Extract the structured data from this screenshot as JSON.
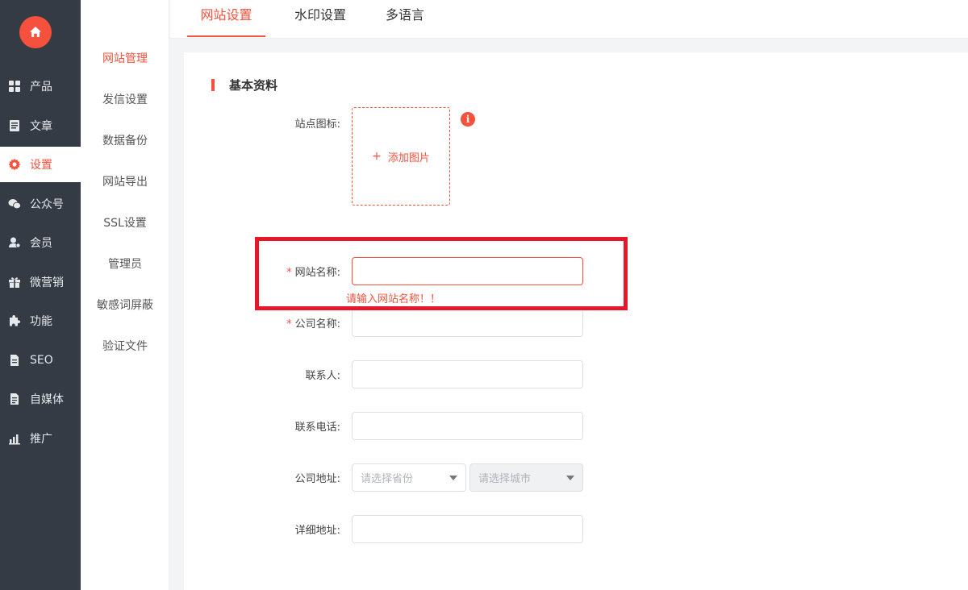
{
  "sidebar": {
    "items": [
      {
        "label": "产品",
        "icon": "grid-icon"
      },
      {
        "label": "文章",
        "icon": "document-icon"
      },
      {
        "label": "设置",
        "icon": "gear-icon",
        "active": true
      },
      {
        "label": "公众号",
        "icon": "wechat-icon"
      },
      {
        "label": "会员",
        "icon": "user-icon"
      },
      {
        "label": "微营销",
        "icon": "gift-icon"
      },
      {
        "label": "功能",
        "icon": "puzzle-icon"
      },
      {
        "label": "SEO",
        "icon": "seo-file-icon"
      },
      {
        "label": "自媒体",
        "icon": "media-file-icon"
      },
      {
        "label": "推广",
        "icon": "chart-icon"
      }
    ]
  },
  "submenu": {
    "items": [
      "网站管理",
      "发信设置",
      "数据备份",
      "网站导出",
      "SSL设置",
      "管理员",
      "敏感词屏蔽",
      "验证文件"
    ]
  },
  "tabs": [
    "网站设置",
    "水印设置",
    "多语言"
  ],
  "form": {
    "section_title": "基本资料",
    "site_icon_label": "站点图标:",
    "upload_label": "添加图片",
    "upload_plus": "+",
    "info_glyph": "i",
    "required_mark": "*",
    "site_name_label": "网站名称:",
    "site_name_error": "请输入网站名称！！",
    "company_name_label": "公司名称:",
    "contact_label": "联系人:",
    "phone_label": "联系电话:",
    "address_label": "公司地址:",
    "province_placeholder": "请选择省份",
    "city_placeholder": "请选择城市",
    "detail_address_label": "详细地址:"
  },
  "colors": {
    "accent": "#f5513d",
    "sidebar_bg": "#353b45",
    "highlight_box": "#e4172b"
  }
}
